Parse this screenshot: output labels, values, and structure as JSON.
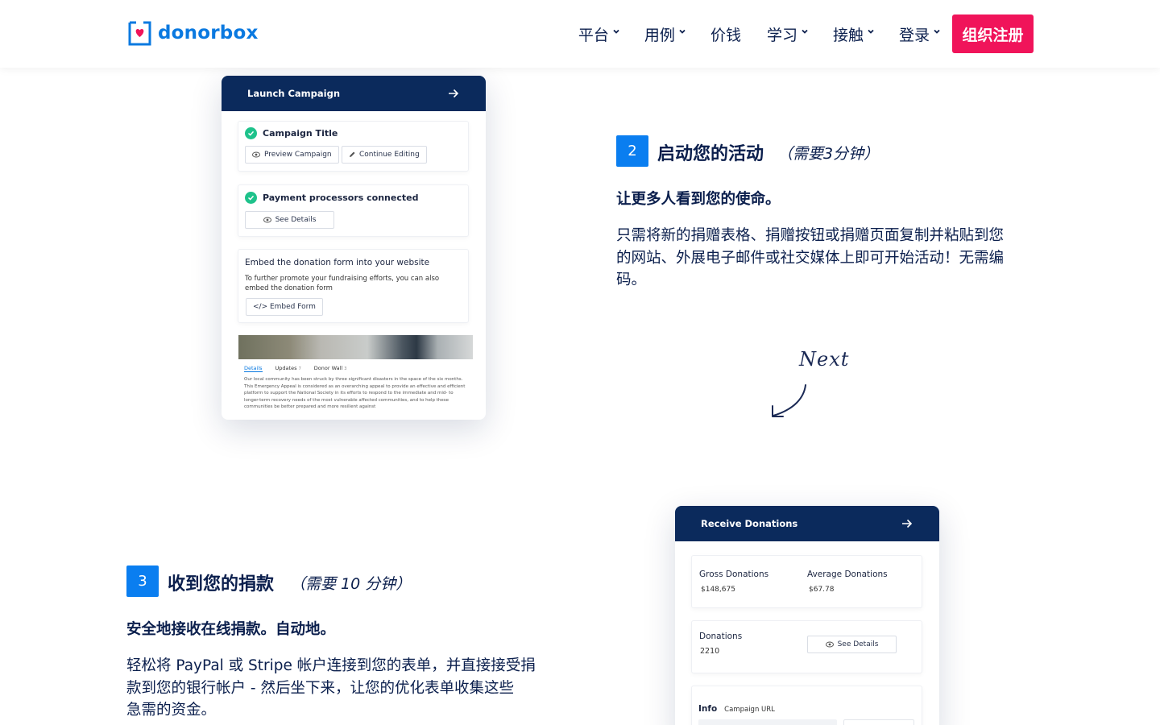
{
  "header": {
    "logo_text": "donorbox",
    "nav": [
      {
        "label": "平台",
        "dropdown": true
      },
      {
        "label": "用例",
        "dropdown": true
      },
      {
        "label": "价钱",
        "dropdown": false
      },
      {
        "label": "学习",
        "dropdown": true
      },
      {
        "label": "接触",
        "dropdown": true
      },
      {
        "label": "登录",
        "dropdown": true
      }
    ],
    "signup_label": "组织注册"
  },
  "launch_card": {
    "title": "Launch Campaign",
    "campaign_title": "Campaign Title",
    "preview_btn": "Preview Campaign",
    "continue_btn": "Continue Editing",
    "processors": "Payment processors connected",
    "see_details": "See Details",
    "embed_title": "Embed the donation form into your website",
    "embed_desc": "To further promote your fundraising efforts, you can also embed the donation form",
    "embed_btn": "</> Embed Form",
    "tabs": [
      "Details",
      "Updates",
      "Donor Wall"
    ],
    "tab_counts": [
      "7",
      "3"
    ],
    "preview_text": "Our local community has been struck by three significant disasters in the space of the six months. This Emergency Appeal is considered as an overarching appeal to provide an effective and efficient platform to support the National Society in its efforts to respond to the immediate and mid- to longer-term recovery needs of the most vulnerable affected communities, and to help these communities be better prepared and more resilient against"
  },
  "step2": {
    "number": "2",
    "title": "启动您的活动",
    "time": "（需要3分钟）",
    "subtitle": "让更多人看到您的使命。",
    "desc_lines": [
      "只需将新的捐赠表格、捐赠按钮或捐赠页面复制并粘贴到您",
      "的网站、外展电子邮件或社交媒体上即可开始活动！无需编",
      "码。"
    ]
  },
  "next_label": "Next",
  "step3": {
    "number": "3",
    "title": "收到您的捐款",
    "time": "（需要 10 分钟）",
    "subtitle": "安全地接收在线捐款。自动地。",
    "desc_lines": [
      "轻松将 PayPal 或 Stripe 帐户连接到您的表单，并直接接受捐",
      "款到您的银行帐户 - 然后坐下来，让您的优化表单收集这些",
      "急需的资金。"
    ]
  },
  "receive_card": {
    "title": "Receive Donations",
    "gross_label": "Gross Donations",
    "gross_value": "$148,675",
    "avg_label": "Average Donations",
    "avg_value": "$67.78",
    "donations_label": "Donations",
    "donations_value": "2210",
    "see_details": "See Details",
    "info_label": "Info",
    "campaign_url_label": "Campaign URL"
  },
  "colors": {
    "brand_blue": "#0a79e0",
    "navy": "#0b2a5c",
    "signup_pink": "#f0145a",
    "step_blue": "#0a7ef0",
    "check_green": "#1ec28b"
  }
}
